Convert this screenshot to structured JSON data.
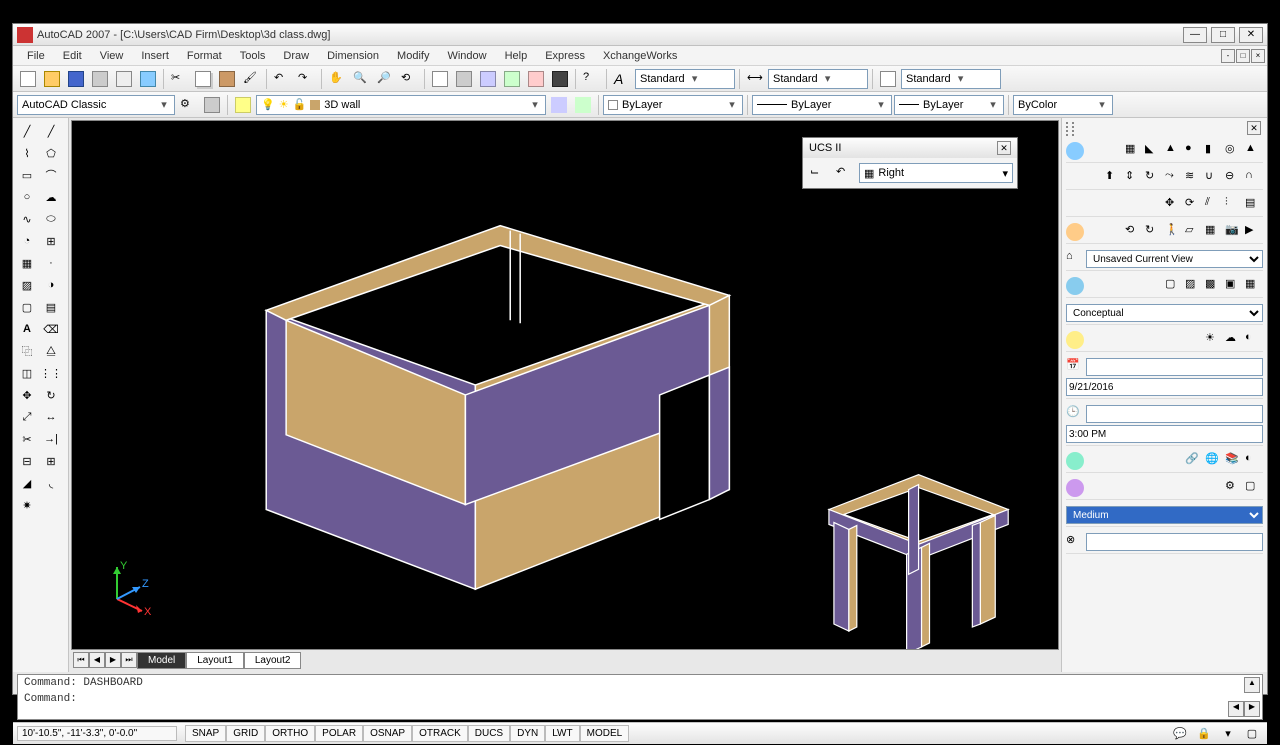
{
  "window": {
    "title": "AutoCAD 2007 - [C:\\Users\\CAD Firm\\Desktop\\3d class.dwg]"
  },
  "menu": [
    "File",
    "Edit",
    "View",
    "Insert",
    "Format",
    "Tools",
    "Draw",
    "Dimension",
    "Modify",
    "Window",
    "Help",
    "Express",
    "XchangeWorks"
  ],
  "toolbar1": {
    "workspace": "AutoCAD Classic",
    "layer": "3D wall",
    "style1": "Standard",
    "style2": "Standard",
    "style3": "Standard"
  },
  "toolbar2": {
    "linetype": "ByLayer",
    "lineweight": "ByLayer",
    "plotstyle": "ByLayer",
    "color": "ByColor"
  },
  "ucs": {
    "title": "UCS II",
    "value": "Right"
  },
  "dashboard": {
    "view": "Unsaved Current View",
    "visual_style": "Conceptual",
    "date": "9/21/2016",
    "time": "3:00 PM",
    "medium": "Medium"
  },
  "tabs": {
    "items": [
      "Model",
      "Layout1",
      "Layout2"
    ],
    "active": 0
  },
  "command": {
    "line1": "Command: DASHBOARD",
    "prompt": "Command:"
  },
  "status": {
    "coords": "10'-10.5\", -11'-3.3\", 0'-0.0\"",
    "toggles": [
      "SNAP",
      "GRID",
      "ORTHO",
      "POLAR",
      "OSNAP",
      "OTRACK",
      "DUCS",
      "DYN",
      "LWT",
      "MODEL"
    ]
  },
  "axis": {
    "x": "X",
    "y": "Y",
    "z": "Z"
  },
  "colors": {
    "wall_face": "#6b5a94",
    "wall_top": "#c9a56b",
    "accent": "#316ac5"
  }
}
